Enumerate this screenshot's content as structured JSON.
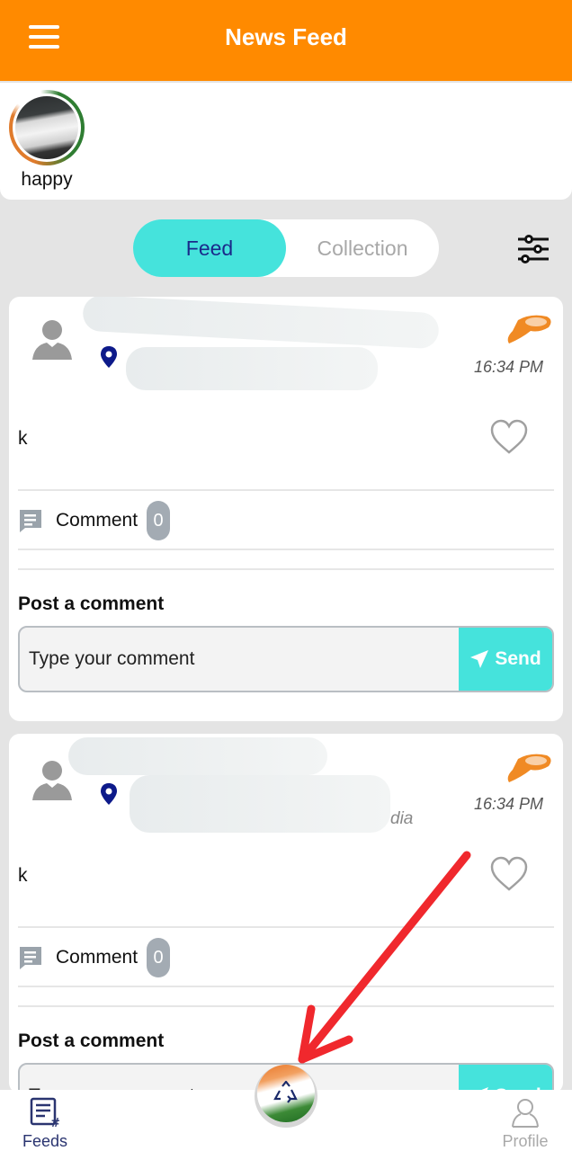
{
  "appbar": {
    "title": "News Feed",
    "menu_icon": "hamburger-menu-icon",
    "color": "#ff8a00"
  },
  "stories": [
    {
      "label": "happy"
    }
  ],
  "tabs": {
    "items": [
      {
        "label": "Feed",
        "active": true
      },
      {
        "label": "Collection",
        "active": false
      }
    ],
    "active_color": "#45e3dc"
  },
  "filter_icon": "sliders-icon",
  "posts": [
    {
      "author": "[redacted]",
      "location": "[redacted]",
      "time": "16:34 PM",
      "text": "k",
      "liked": false,
      "comment_label": "Comment",
      "comment_count": "0",
      "post_comment_label": "Post a comment",
      "comment_placeholder": "Type your comment",
      "send_label": "Send"
    },
    {
      "author": "[redacted]",
      "location": "[redacted]",
      "location_suffix_visible": "dia",
      "time": "16:34 PM",
      "text": "k",
      "liked": false,
      "comment_label": "Comment",
      "comment_count": "0",
      "post_comment_label": "Post a comment",
      "comment_placeholder": "Type your comment",
      "send_label": "Send"
    }
  ],
  "bottom_nav": {
    "items": [
      {
        "label": "Feeds",
        "icon": "feeds-icon",
        "active": true
      },
      {
        "label": "Profile",
        "icon": "profile-icon",
        "active": false
      }
    ],
    "center_button_icon": "recycle-icon"
  },
  "annotation": {
    "type": "arrow",
    "color": "#f0282d",
    "points_to": "center-recycle-button"
  }
}
